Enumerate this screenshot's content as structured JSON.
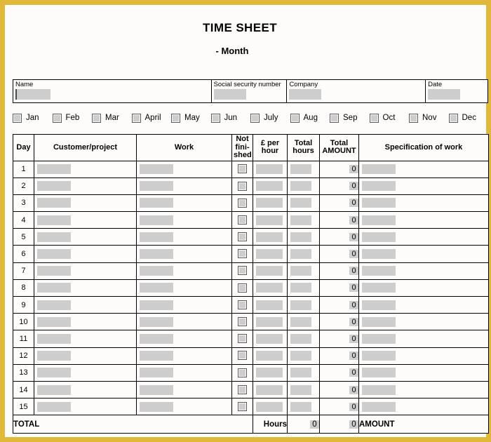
{
  "document": {
    "title": "TIME SHEET",
    "subtitle": "- Month",
    "border_color": "#e0b93a",
    "fill_color": "#cdcdcd"
  },
  "header_fields": [
    {
      "label": "Name",
      "value": ""
    },
    {
      "label": "Social security number",
      "value": ""
    },
    {
      "label": "Company",
      "value": ""
    },
    {
      "label": "Date",
      "value": ""
    }
  ],
  "months": [
    {
      "label": "Jan",
      "checked": false
    },
    {
      "label": "Feb",
      "checked": false
    },
    {
      "label": "Mar",
      "checked": false
    },
    {
      "label": "April",
      "checked": false
    },
    {
      "label": "May",
      "checked": false
    },
    {
      "label": "Jun",
      "checked": false
    },
    {
      "label": "July",
      "checked": false
    },
    {
      "label": "Aug",
      "checked": false
    },
    {
      "label": "Sep",
      "checked": false
    },
    {
      "label": "Oct",
      "checked": false
    },
    {
      "label": "Nov",
      "checked": false
    },
    {
      "label": "Dec",
      "checked": false
    }
  ],
  "table": {
    "columns": [
      {
        "key": "day",
        "label": "Day"
      },
      {
        "key": "cust",
        "label": "Customer/project"
      },
      {
        "key": "work",
        "label": "Work"
      },
      {
        "key": "nf",
        "label_line1": "Not",
        "label_line2": "fini-",
        "label_line3": "shed"
      },
      {
        "key": "rate",
        "label_line1": "£ per",
        "label_line2": "hour"
      },
      {
        "key": "hours",
        "label_line1": "Total",
        "label_line2": "hours"
      },
      {
        "key": "amt",
        "label_line1": "Total",
        "label_line2": "AMOUNT"
      },
      {
        "key": "spec",
        "label": "Specification of work"
      }
    ],
    "rows": [
      {
        "day": "1",
        "amount": "0"
      },
      {
        "day": "2",
        "amount": "0"
      },
      {
        "day": "3",
        "amount": "0"
      },
      {
        "day": "4",
        "amount": "0"
      },
      {
        "day": "5",
        "amount": "0"
      },
      {
        "day": "6",
        "amount": "0"
      },
      {
        "day": "7",
        "amount": "0"
      },
      {
        "day": "8",
        "amount": "0"
      },
      {
        "day": "9",
        "amount": "0"
      },
      {
        "day": "10",
        "amount": "0"
      },
      {
        "day": "11",
        "amount": "0"
      },
      {
        "day": "12",
        "amount": "0"
      },
      {
        "day": "13",
        "amount": "0"
      },
      {
        "day": "14",
        "amount": "0"
      },
      {
        "day": "15",
        "amount": "0"
      }
    ],
    "footer": {
      "total_label": "TOTAL",
      "hours_label": "Hours",
      "hours_value": "0",
      "amount_value": "0",
      "amount_label": "AMOUNT"
    }
  }
}
